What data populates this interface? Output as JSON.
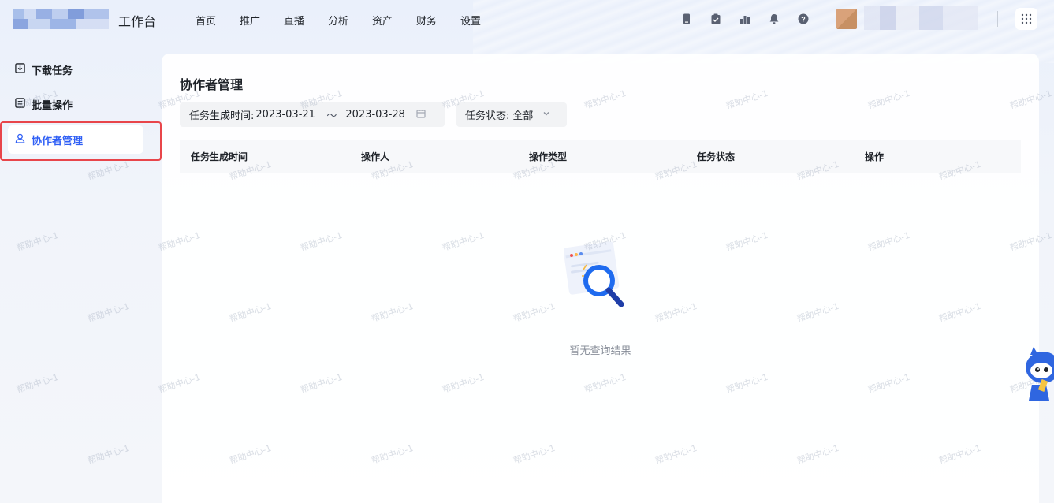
{
  "header": {
    "app_title": "工作台",
    "nav": [
      {
        "label": "首页"
      },
      {
        "label": "推广"
      },
      {
        "label": "直播"
      },
      {
        "label": "分析"
      },
      {
        "label": "资产"
      },
      {
        "label": "财务"
      },
      {
        "label": "设置"
      }
    ],
    "icons": [
      "phone-icon",
      "clipboard-icon",
      "chart-icon",
      "bell-icon",
      "help-icon"
    ],
    "apps_icon": "grid-apps-icon"
  },
  "sidebar": {
    "items": [
      {
        "label": "下载任务",
        "icon": "download-icon",
        "active": false
      },
      {
        "label": "批量操作",
        "icon": "list-icon",
        "active": false
      },
      {
        "label": "协作者管理",
        "icon": "user-icon",
        "active": true
      }
    ]
  },
  "main": {
    "title": "协作者管理",
    "filters": {
      "date_label": "任务生成时间:",
      "date_start": "2023-03-21",
      "date_sep": "～",
      "date_end": "2023-03-28",
      "status_label": "任务状态:",
      "status_value": "全部"
    },
    "table": {
      "columns": [
        "任务生成时间",
        "操作人",
        "操作类型",
        "任务状态",
        "操作"
      ],
      "rows": []
    },
    "empty_text": "暂无查询结果"
  },
  "watermark_text": "帮助中心-1",
  "colors": {
    "accent": "#2f5ff5",
    "highlight_border": "#e8454a",
    "card_bg": "#ffffff"
  }
}
